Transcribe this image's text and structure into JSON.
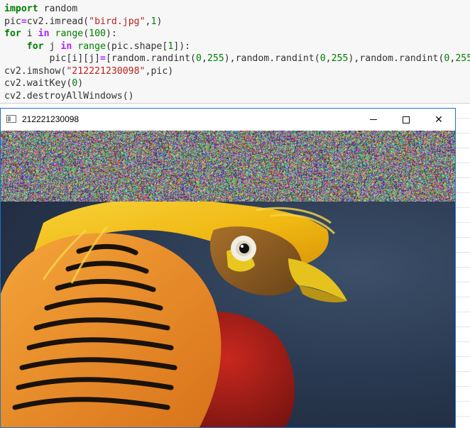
{
  "code_cell": {
    "lines": [
      [
        {
          "t": "import",
          "c": "kw"
        },
        {
          "t": " random",
          "c": "nm"
        }
      ],
      [
        {
          "t": "pic",
          "c": "nm"
        },
        {
          "t": "=",
          "c": "op"
        },
        {
          "t": "cv2.imread(",
          "c": "nm"
        },
        {
          "t": "\"bird.jpg\"",
          "c": "st"
        },
        {
          "t": ",",
          "c": "pu"
        },
        {
          "t": "1",
          "c": "nu"
        },
        {
          "t": ")",
          "c": "pu"
        }
      ],
      [
        {
          "t": "for",
          "c": "kw"
        },
        {
          "t": " i ",
          "c": "nm"
        },
        {
          "t": "in",
          "c": "op"
        },
        {
          "t": " ",
          "c": "nm"
        },
        {
          "t": "range",
          "c": "bi"
        },
        {
          "t": "(",
          "c": "pu"
        },
        {
          "t": "100",
          "c": "nu"
        },
        {
          "t": "):",
          "c": "pu"
        }
      ],
      [
        {
          "t": "    ",
          "c": "nm"
        },
        {
          "t": "for",
          "c": "kw"
        },
        {
          "t": " j ",
          "c": "nm"
        },
        {
          "t": "in",
          "c": "op"
        },
        {
          "t": " ",
          "c": "nm"
        },
        {
          "t": "range",
          "c": "bi"
        },
        {
          "t": "(pic.shape[",
          "c": "pu"
        },
        {
          "t": "1",
          "c": "nu"
        },
        {
          "t": "]):",
          "c": "pu"
        }
      ],
      [
        {
          "t": "        pic[i][j]",
          "c": "nm"
        },
        {
          "t": "=",
          "c": "op"
        },
        {
          "t": "[random.randint(",
          "c": "nm"
        },
        {
          "t": "0",
          "c": "nu"
        },
        {
          "t": ",",
          "c": "pu"
        },
        {
          "t": "255",
          "c": "nu"
        },
        {
          "t": "),random.randint(",
          "c": "nm"
        },
        {
          "t": "0",
          "c": "nu"
        },
        {
          "t": ",",
          "c": "pu"
        },
        {
          "t": "255",
          "c": "nu"
        },
        {
          "t": "),random.randint(",
          "c": "nm"
        },
        {
          "t": "0",
          "c": "nu"
        },
        {
          "t": ",",
          "c": "pu"
        },
        {
          "t": "255",
          "c": "nu"
        },
        {
          "t": ")]",
          "c": "pu"
        }
      ],
      [
        {
          "t": "cv2.imshow(",
          "c": "nm"
        },
        {
          "t": "\"212221230098\"",
          "c": "st"
        },
        {
          "t": ",pic)",
          "c": "pu"
        }
      ],
      [
        {
          "t": "cv2.waitKey(",
          "c": "nm"
        },
        {
          "t": "0",
          "c": "nu"
        },
        {
          "t": ")",
          "c": "pu"
        }
      ],
      [
        {
          "t": "cv2.destroyAllWindows()",
          "c": "nm"
        }
      ]
    ]
  },
  "window": {
    "title": "212221230098",
    "app_icon": "window-icon",
    "buttons": {
      "minimize": "minimize-icon",
      "maximize": "maximize-icon",
      "close": "close-icon",
      "close_glyph": "✕"
    }
  },
  "image": {
    "noise_rows_fraction": 0.239,
    "description_colors": {
      "background": "#24344a",
      "crest": "#f2c21a",
      "cape_orange": "#e88a1e",
      "breast_red": "#b01f1a",
      "beak": "#e6c21f"
    }
  }
}
